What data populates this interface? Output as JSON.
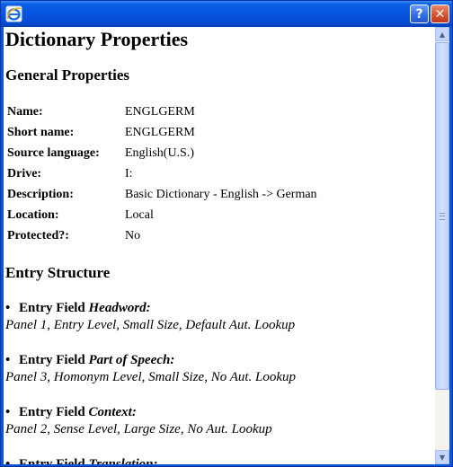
{
  "window": {
    "help_label": "?",
    "close_label": "✕"
  },
  "page": {
    "title": "Dictionary Properties",
    "general_heading": "General Properties",
    "properties": [
      {
        "label": "Name:",
        "value": "ENGLGERM"
      },
      {
        "label": "Short name:",
        "value": "ENGLGERM"
      },
      {
        "label": "Source language:",
        "value": "English(U.S.)"
      },
      {
        "label": "Drive:",
        "value": "I:"
      },
      {
        "label": "Description:",
        "value": "Basic Dictionary - English -> German"
      },
      {
        "label": "Location:",
        "value": "Local"
      },
      {
        "label": "Protected?:",
        "value": "No"
      }
    ],
    "entry_heading": "Entry Structure",
    "entry_prefix": "Entry Field",
    "entries": [
      {
        "name": "Headword:",
        "desc": "Panel 1, Entry Level, Small Size, Default Aut. Lookup"
      },
      {
        "name": "Part of Speech:",
        "desc": "Panel 3, Homonym Level, Small Size, No Aut. Lookup"
      },
      {
        "name": "Context:",
        "desc": "Panel 2, Sense Level, Large Size, No Aut. Lookup"
      },
      {
        "name": "Translation:",
        "desc": ""
      }
    ]
  },
  "icons": {
    "app_icon": "internet-explorer-icon",
    "bullet": "•"
  },
  "colors": {
    "titlebar": "#0754e0",
    "close_button": "#d6502c",
    "scrollbar_thumb": "#bcd0fa"
  }
}
